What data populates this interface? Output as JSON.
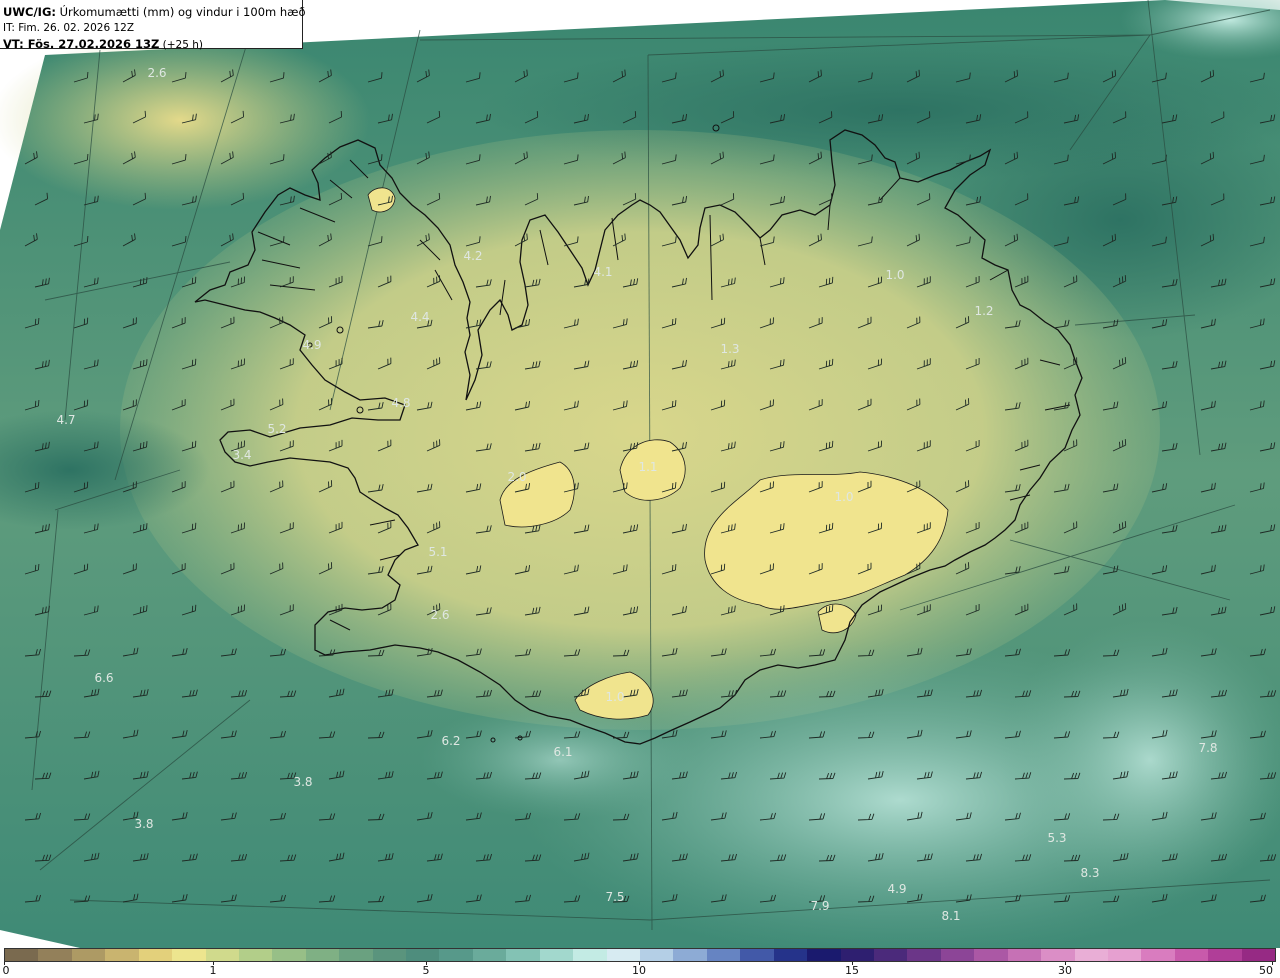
{
  "header": {
    "product": "UWC/IG:",
    "field_title": " Úrkomumætti (mm) og vindur i 100m hæð",
    "issue_time": "IT: Fim. 26. 02. 2026 12Z",
    "valid_prefix": "VT:",
    "valid_time": " Fös. 27.02.2026 13Z",
    "lead_time": " (+25 h)"
  },
  "map": {
    "region": "Iceland",
    "field": "precipitable water",
    "wind_level": "100m",
    "background_colors": [
      "#2f7c66",
      "#8fb07a",
      "#e2df8e",
      "#5fa38e",
      "#bfe6dc"
    ],
    "coast_color": "#111111",
    "value_labels": [
      {
        "text": "2.6"
      },
      {
        "text": "4.2"
      },
      {
        "text": "4.1"
      },
      {
        "text": "1.0"
      },
      {
        "text": "4.4"
      },
      {
        "text": "4.9"
      },
      {
        "text": "1.2"
      },
      {
        "text": "1.3"
      },
      {
        "text": "4.8"
      },
      {
        "text": "4.7"
      },
      {
        "text": "5.2"
      },
      {
        "text": "3.4"
      },
      {
        "text": "2.0"
      },
      {
        "text": "1.1"
      },
      {
        "text": "1.0"
      },
      {
        "text": "5.1"
      },
      {
        "text": "2.6"
      },
      {
        "text": "1.0"
      },
      {
        "text": "6.6"
      },
      {
        "text": "6.2"
      },
      {
        "text": "6.1"
      },
      {
        "text": "3.8"
      },
      {
        "text": "3.8"
      },
      {
        "text": "7.8"
      },
      {
        "text": "5.3"
      },
      {
        "text": "8.3"
      },
      {
        "text": "7.5"
      },
      {
        "text": "7.9"
      },
      {
        "text": "4.9"
      },
      {
        "text": "8.1"
      }
    ]
  },
  "colorbar": {
    "colors": [
      "#7a6a4f",
      "#93805a",
      "#ad9a64",
      "#c9b46f",
      "#e3d07b",
      "#ede58e",
      "#d0da8c",
      "#b2ce89",
      "#97bf87",
      "#7fb084",
      "#6aa180",
      "#5a947d",
      "#4e8d7d",
      "#57998a",
      "#6aab9b",
      "#83c2b4",
      "#a2d8cd",
      "#c3ebe4",
      "#d7ebf2",
      "#b4cfe6",
      "#8dabd5",
      "#6684c2",
      "#4259a8",
      "#25338a",
      "#1a1a6e",
      "#2e1f70",
      "#4b2a7b",
      "#6b3688",
      "#8c4597",
      "#ab58a5",
      "#c671b5",
      "#db8ec6",
      "#e9aed6",
      "#e6a0d0",
      "#d97cbf",
      "#c85aab",
      "#b03e98",
      "#962a84"
    ],
    "ticks": [
      "0",
      "1",
      "5",
      "10",
      "15",
      "30",
      "50"
    ]
  }
}
